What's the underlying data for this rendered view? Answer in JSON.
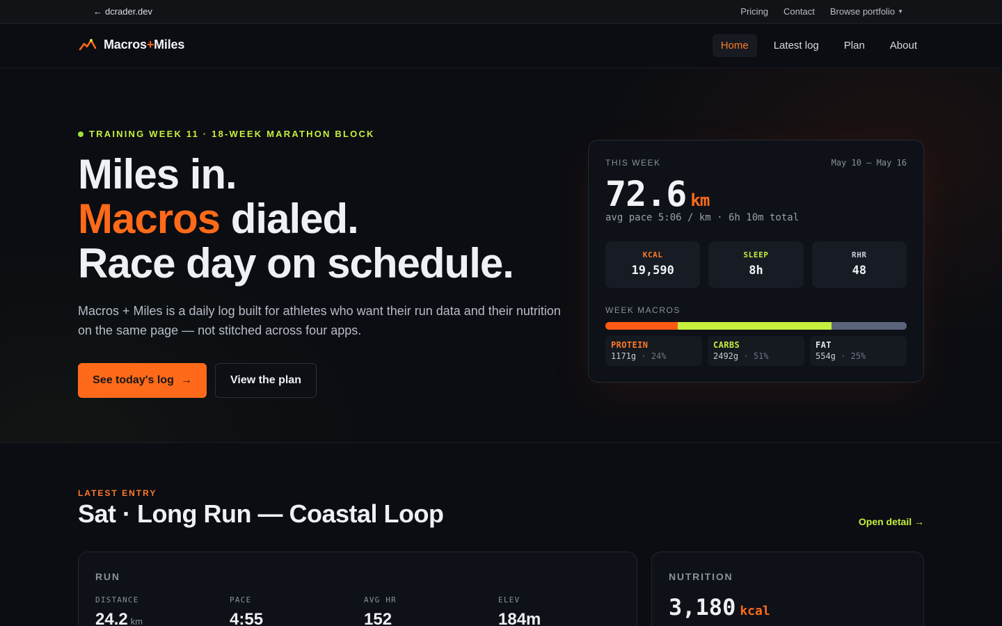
{
  "topbar": {
    "back_label": "dcrader.dev",
    "links": [
      "Pricing",
      "Contact",
      "Browse portfolio"
    ]
  },
  "nav": {
    "brand_left": "Macros",
    "brand_plus": "+",
    "brand_right": "Miles",
    "items": [
      {
        "label": "Home",
        "active": true
      },
      {
        "label": "Latest log",
        "active": false
      },
      {
        "label": "Plan",
        "active": false
      },
      {
        "label": "About",
        "active": false
      }
    ]
  },
  "hero": {
    "eyebrow": "TRAINING WEEK 11 · 18-WEEK MARATHON BLOCK",
    "line1": "Miles in.",
    "line2_accent": "Macros",
    "line2_rest": " dialed.",
    "line3": "Race day on schedule.",
    "lede": "Macros + Miles is a daily log built for athletes who want their run data and their nutrition on the same page — not stitched across four apps.",
    "primary_cta": "See today's log",
    "secondary_cta": "View the plan"
  },
  "week_card": {
    "label": "THIS WEEK",
    "range": "May 10 – May 16",
    "distance": "72.6",
    "distance_unit": "km",
    "summary": "avg pace 5:06 / km · 6h 10m total",
    "stats": [
      {
        "key": "KCAL",
        "value": "19,590",
        "color": "#ff7a2a"
      },
      {
        "key": "SLEEP",
        "value": "8h",
        "color": "#c6ef3e"
      },
      {
        "key": "RHR",
        "value": "48",
        "color": "#c9ccd6"
      }
    ],
    "macros_label": "WEEK MACROS",
    "macros": [
      {
        "key": "PROTEIN",
        "grams": "1171g",
        "pct": "24%",
        "fraction": 0.24,
        "color": "#ff5a14"
      },
      {
        "key": "CARBS",
        "grams": "2492g",
        "pct": "51%",
        "fraction": 0.51,
        "color": "#c6ef3e"
      },
      {
        "key": "FAT",
        "grams": "554g",
        "pct": "25%",
        "fraction": 0.25,
        "color": "#5b647a"
      }
    ]
  },
  "latest": {
    "eyebrow": "LATEST ENTRY",
    "title": "Sat · Long Run — Coastal Loop",
    "open_detail": "Open detail",
    "run": {
      "title": "RUN",
      "stats": [
        {
          "key": "DISTANCE",
          "value": "24.2",
          "unit": "km"
        },
        {
          "key": "PACE",
          "value": "4:55",
          "unit": ""
        },
        {
          "key": "AVG HR",
          "value": "152",
          "unit": ""
        },
        {
          "key": "ELEV",
          "value": "184m",
          "unit": ""
        }
      ]
    },
    "nutrition": {
      "title": "NUTRITION",
      "value": "3,180",
      "unit": "kcal"
    }
  },
  "colors": {
    "accent_orange": "#ff6a1a",
    "accent_lime": "#c6ef3e",
    "background": "#0b0d12"
  }
}
